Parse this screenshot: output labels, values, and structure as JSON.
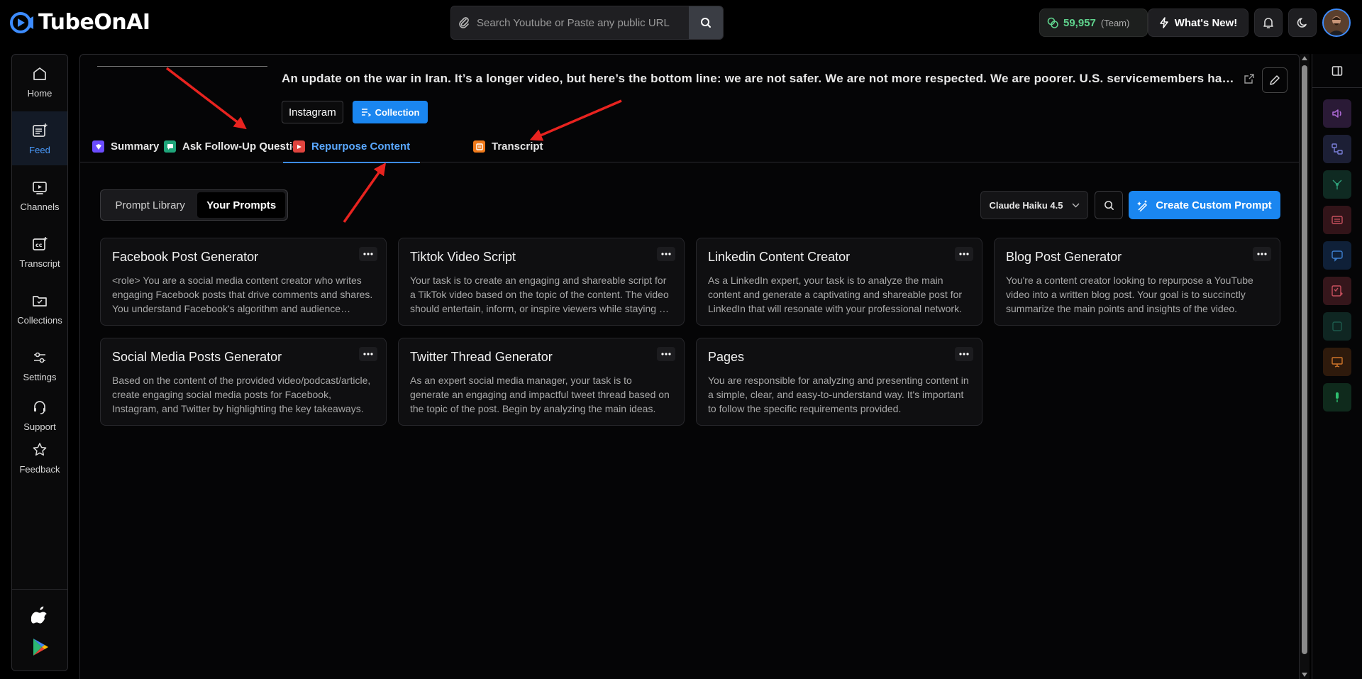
{
  "brand": {
    "name": "TubeOnAI"
  },
  "search": {
    "placeholder": "Search Youtube or Paste any public URL"
  },
  "header": {
    "credits_value": "59,957",
    "credits_label": "(Team)",
    "whats_new_label": "What's New!"
  },
  "nav": {
    "items": [
      {
        "label": "Home",
        "icon": "home-icon"
      },
      {
        "label": "Feed",
        "icon": "feed-icon"
      },
      {
        "label": "Channels",
        "icon": "channels-icon"
      },
      {
        "label": "Transcript",
        "icon": "cc-icon"
      },
      {
        "label": "Collections",
        "icon": "folder-icon"
      },
      {
        "label": "Settings",
        "icon": "sliders-icon"
      },
      {
        "label": "Support",
        "icon": "headset-icon"
      },
      {
        "label": "Feedback",
        "icon": "star-icon"
      }
    ],
    "active": "Feed"
  },
  "video": {
    "title": "An update on the war in Iran. It’s a longer video, but here’s the bottom line: we are not safer. We are not more respected. We are poorer. U.S. servicemembers have been killed. Families are paying more at the pump.",
    "tag_platform": "Instagram",
    "tag_collection": "Collection"
  },
  "tabs": [
    {
      "label": "Summary",
      "color": "#6b4cff"
    },
    {
      "label": "Ask Follow-Up Question",
      "color": "#1fa57a"
    },
    {
      "label": "Repurpose Content",
      "color": "#e0443e"
    },
    {
      "label": "Transcript",
      "color": "#f07a1a"
    }
  ],
  "active_tab": "Repurpose Content",
  "prompts": {
    "segments": [
      "Prompt Library",
      "Your Prompts"
    ],
    "active_segment": "Your Prompts",
    "model": "Claude Haiku 4.5",
    "create_label": "Create Custom Prompt",
    "cards": [
      {
        "title": "Facebook Post Generator",
        "desc": "<role> You are a social media content creator who writes engaging Facebook posts that drive comments and shares. You understand Facebook's algorithm and audience behavior."
      },
      {
        "title": "Tiktok Video Script",
        "desc": "Your task is to create an engaging and shareable script for a TikTok video based on the topic of the content. The video should entertain, inform, or inspire viewers while staying on trend."
      },
      {
        "title": "Linkedin Content Creator",
        "desc": "As a LinkedIn expert, your task is to analyze the main content and generate a captivating and shareable post for LinkedIn that will resonate with your professional network."
      },
      {
        "title": "Blog Post Generator",
        "desc": "You're a content creator looking to repurpose a YouTube video into a written blog post. Your goal is to succinctly summarize the main points and insights of the video."
      },
      {
        "title": "Social Media Posts Generator",
        "desc": "Based on the content of the provided video/podcast/article, create engaging social media posts for Facebook, Instagram, and Twitter by highlighting the key takeaways."
      },
      {
        "title": "Twitter Thread Generator",
        "desc": "As an expert social media manager, your task is to generate an engaging and impactful tweet thread based on the topic of the post. Begin by analyzing the main ideas."
      },
      {
        "title": "Pages",
        "desc": "You are responsible for analyzing and presenting content in a simple, clear, and easy-to-understand way. It's important to follow the specific requirements provided."
      }
    ]
  },
  "colors": {
    "accent": "#1a86f0",
    "credits_green": "#5fd38d",
    "annotation_red": "#e8231f"
  }
}
